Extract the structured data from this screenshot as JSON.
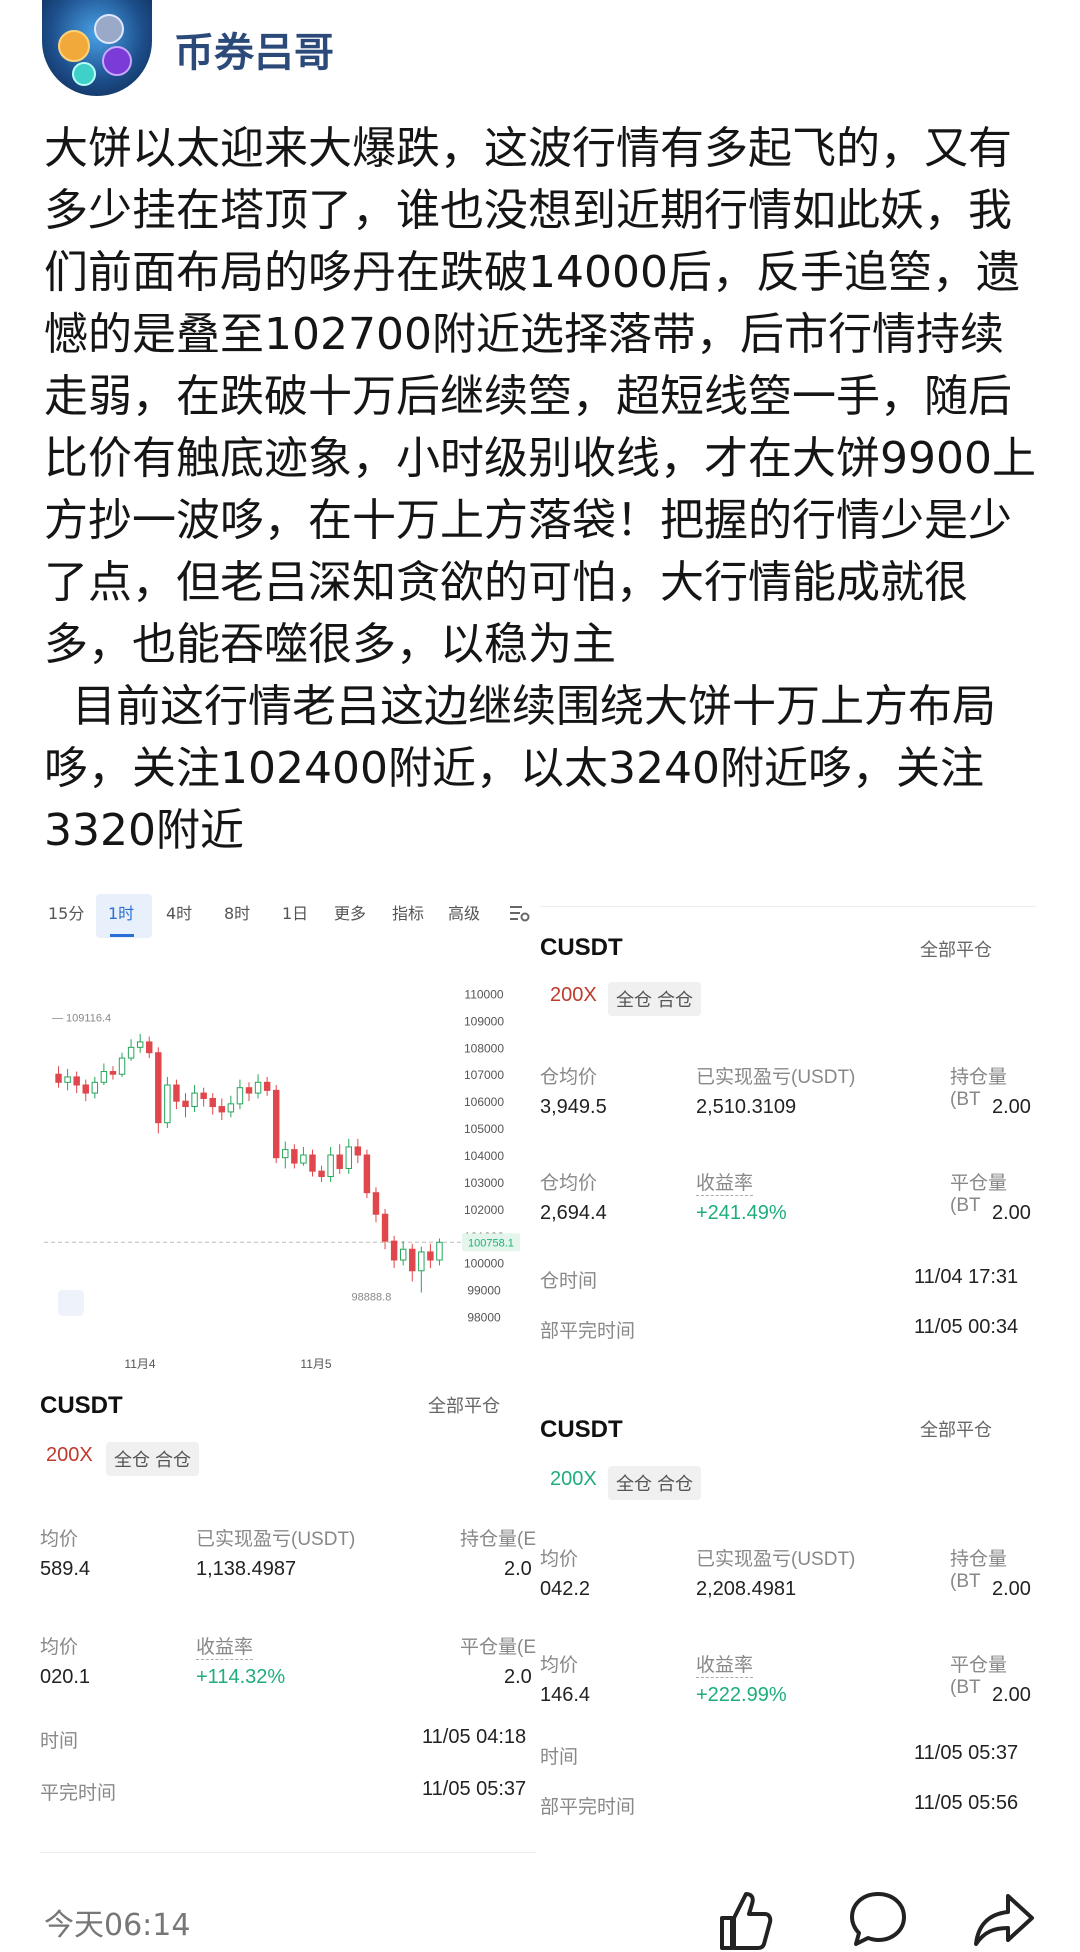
{
  "header": {
    "username": "币券吕哥"
  },
  "post": {
    "paragraph1": "大饼以太迎来大爆跌，这波行情有多起飞的，又有多少挂在塔顶了，谁也没想到近期行情如此妖，我们前面布局的哆丹在跌破14000后，反手追箜，遗憾的是叠至102700附近选择落带，后市行情持续走弱，在跌破十万后继续箜，超短线箜一手，随后比价有触底迹象，小时级别收线，才在大饼9900上方抄一波哆，在十万上方落袋！把握的行情少是少了点，但老吕深知贪欲的可怕，大行情能成就很多，也能吞噬很多，以稳为主",
    "paragraph2": "  目前这行情老吕这边继续围绕大饼十万上方布局哆，关注102400附近，以太3240附近哆，关注3320附近"
  },
  "chart_tabs": [
    "15分",
    "1时",
    "4时",
    "8时",
    "1日",
    "更多",
    "指标",
    "高级"
  ],
  "chart_tab_active": "1时",
  "chart_data": {
    "type": "candlestick",
    "x_labels": [
      "11月4",
      "11月5"
    ],
    "y_ticks": [
      110000,
      109000,
      108000,
      107000,
      106000,
      105000,
      104000,
      103000,
      102000,
      101000,
      100000,
      99000,
      98000
    ],
    "ylim": [
      97500,
      110500
    ],
    "high_label": "109116.4",
    "low_label": "98888.8",
    "current_price": "100758.1",
    "candles": [
      {
        "o": 107000,
        "c": 106700,
        "h": 107300,
        "l": 106500
      },
      {
        "o": 106700,
        "c": 106900,
        "h": 107200,
        "l": 106400
      },
      {
        "o": 106900,
        "c": 106600,
        "h": 107100,
        "l": 106300
      },
      {
        "o": 106600,
        "c": 106300,
        "h": 106800,
        "l": 106000
      },
      {
        "o": 106300,
        "c": 106700,
        "h": 106900,
        "l": 106100
      },
      {
        "o": 106700,
        "c": 107100,
        "h": 107400,
        "l": 106600
      },
      {
        "o": 107100,
        "c": 107000,
        "h": 107300,
        "l": 106800
      },
      {
        "o": 107000,
        "c": 107600,
        "h": 107800,
        "l": 106900
      },
      {
        "o": 107600,
        "c": 108000,
        "h": 108300,
        "l": 107500
      },
      {
        "o": 108000,
        "c": 108200,
        "h": 108500,
        "l": 107800
      },
      {
        "o": 108200,
        "c": 107800,
        "h": 108400,
        "l": 107600
      },
      {
        "o": 107800,
        "c": 105200,
        "h": 108000,
        "l": 104800
      },
      {
        "o": 105200,
        "c": 106600,
        "h": 106900,
        "l": 105000
      },
      {
        "o": 106600,
        "c": 106000,
        "h": 106800,
        "l": 105700
      },
      {
        "o": 106000,
        "c": 105800,
        "h": 106300,
        "l": 105400
      },
      {
        "o": 105800,
        "c": 106300,
        "h": 106600,
        "l": 105600
      },
      {
        "o": 106300,
        "c": 106100,
        "h": 106500,
        "l": 105800
      },
      {
        "o": 106100,
        "c": 105800,
        "h": 106300,
        "l": 105500
      },
      {
        "o": 105800,
        "c": 105600,
        "h": 106100,
        "l": 105300
      },
      {
        "o": 105600,
        "c": 105900,
        "h": 106200,
        "l": 105400
      },
      {
        "o": 105900,
        "c": 106500,
        "h": 106800,
        "l": 105700
      },
      {
        "o": 106500,
        "c": 106300,
        "h": 106700,
        "l": 106000
      },
      {
        "o": 106300,
        "c": 106700,
        "h": 107000,
        "l": 106100
      },
      {
        "o": 106700,
        "c": 106400,
        "h": 106900,
        "l": 106200
      },
      {
        "o": 106400,
        "c": 103900,
        "h": 106600,
        "l": 103700
      },
      {
        "o": 103900,
        "c": 104200,
        "h": 104500,
        "l": 103500
      },
      {
        "o": 104200,
        "c": 103700,
        "h": 104400,
        "l": 103500
      },
      {
        "o": 103700,
        "c": 104000,
        "h": 104300,
        "l": 103600
      },
      {
        "o": 104000,
        "c": 103400,
        "h": 104200,
        "l": 103200
      },
      {
        "o": 103400,
        "c": 103200,
        "h": 103600,
        "l": 103000
      },
      {
        "o": 103200,
        "c": 104000,
        "h": 104300,
        "l": 103000
      },
      {
        "o": 104000,
        "c": 103500,
        "h": 104400,
        "l": 103300
      },
      {
        "o": 103500,
        "c": 104300,
        "h": 104600,
        "l": 103300
      },
      {
        "o": 104300,
        "c": 104000,
        "h": 104600,
        "l": 103700
      },
      {
        "o": 104000,
        "c": 102600,
        "h": 104200,
        "l": 102400
      },
      {
        "o": 102600,
        "c": 101800,
        "h": 102800,
        "l": 101500
      },
      {
        "o": 101800,
        "c": 100800,
        "h": 102000,
        "l": 100500
      },
      {
        "o": 100800,
        "c": 100100,
        "h": 101000,
        "l": 99800
      },
      {
        "o": 100100,
        "c": 100500,
        "h": 100800,
        "l": 99900
      },
      {
        "o": 100500,
        "c": 99700,
        "h": 100700,
        "l": 99300
      },
      {
        "o": 99700,
        "c": 100400,
        "h": 100600,
        "l": 98888.8
      },
      {
        "o": 100400,
        "c": 100100,
        "h": 100700,
        "l": 99800
      },
      {
        "o": 100100,
        "c": 100758.1,
        "h": 100900,
        "l": 99900
      }
    ]
  },
  "positions": [
    {
      "symbol": "CUSDT",
      "close_all": "全部平仓",
      "leverage": "200X",
      "leverage_color": "#c0392b",
      "mode": "全仓 合仓",
      "label_open_avg": "仓均价",
      "open_avg": "3,949.5",
      "label_realized": "已实现盈亏(USDT)",
      "realized": "2,510.3109",
      "label_hold": "持仓量(BT",
      "hold": "2.00",
      "label_close_avg": "仓均价",
      "close_avg": "2,694.4",
      "label_yield": "收益率",
      "yield": "+241.49%",
      "label_closed": "平仓量(BT",
      "closed": "2.00",
      "label_open_time": "仓时间",
      "open_time": "11/04 17:31",
      "label_close_time": "部平完时间",
      "close_time": "11/05 00:34"
    },
    {
      "symbol": "CUSDT",
      "close_all": "全部平仓",
      "leverage": "200X",
      "leverage_color": "#c0392b",
      "mode": "全仓 合仓",
      "label_open_avg": "均价",
      "open_avg": "589.4",
      "label_realized": "已实现盈亏(USDT)",
      "realized": "1,138.4987",
      "label_hold": "持仓量(E",
      "hold": "2.0",
      "label_close_avg": "均价",
      "close_avg": "020.1",
      "label_yield": "收益率",
      "yield": "+114.32%",
      "label_closed": "平仓量(E",
      "closed": "2.0",
      "label_open_time": "时间",
      "open_time": "11/05 04:18",
      "label_close_time": "平完时间",
      "close_time": "11/05 05:37"
    },
    {
      "symbol": "CUSDT",
      "close_all": "全部平仓",
      "leverage": "200X",
      "leverage_color": "#1fae7b",
      "mode": "全仓 合仓",
      "label_open_avg": "均价",
      "open_avg": "042.2",
      "label_realized": "已实现盈亏(USDT)",
      "realized": "2,208.4981",
      "label_hold": "持仓量(BT",
      "hold": "2.00",
      "label_close_avg": "均价",
      "close_avg": "146.4",
      "label_yield": "收益率",
      "yield": "+222.99%",
      "label_closed": "平仓量(BT",
      "closed": "2.00",
      "label_open_time": "时间",
      "open_time": "11/05 05:37",
      "label_close_time": "部平完时间",
      "close_time": "11/05 05:56"
    }
  ],
  "footer": {
    "time": "今天06:14",
    "icons": [
      "like-icon",
      "comment-icon",
      "share-icon"
    ]
  }
}
